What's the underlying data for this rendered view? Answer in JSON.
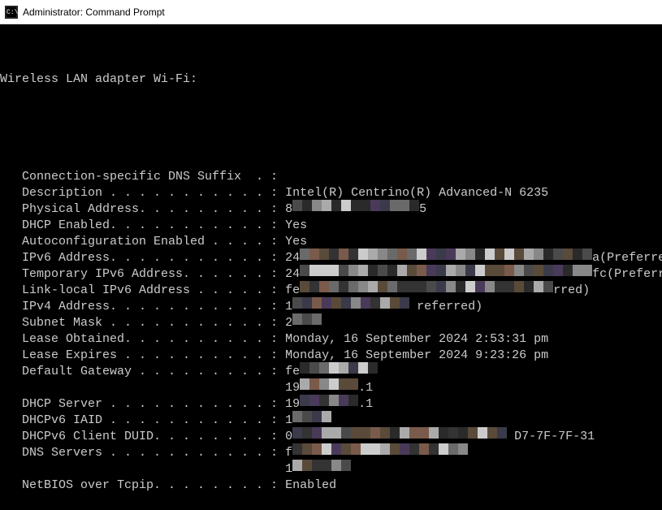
{
  "titlebar": {
    "title": "Administrator: Command Prompt"
  },
  "terminal": {
    "header": "Wireless LAN adapter Wi-Fi:",
    "rows": [
      {
        "label": "   Connection-specific DNS Suffix  . :",
        "value": ""
      },
      {
        "label": "   Description . . . . . . . . . . . : ",
        "value": "Intel(R) Centrino(R) Advanced-N 6235"
      },
      {
        "label": "   Physical Address. . . . . . . . . : ",
        "value_prefix": "8",
        "value_suffix": "5",
        "redacted": true,
        "redact_width": 13
      },
      {
        "label": "   DHCP Enabled. . . . . . . . . . . : ",
        "value": "Yes"
      },
      {
        "label": "   Autoconfiguration Enabled . . . . : ",
        "value": "Yes"
      },
      {
        "label": "   IPv6 Address. . . . . . . . . . . : ",
        "value_prefix": "24",
        "value_suffix": "a(Preferred)",
        "redacted": true,
        "redact_width": 30
      },
      {
        "label": "   Temporary IPv6 Address. . . . . . : ",
        "value_prefix": "24",
        "value_suffix": "fc(Preferred)",
        "redacted": true,
        "redact_width": 30
      },
      {
        "label": "   Link-local IPv6 Address . . . . . : ",
        "value_prefix": "fe",
        "value_suffix": "rred)",
        "redacted": true,
        "redact_width": 26
      },
      {
        "label": "   IPv4 Address. . . . . . . . . . . : ",
        "value_prefix": "1",
        "value_mid": " referred)",
        "redacted": true,
        "redact_width": 12
      },
      {
        "label": "   Subnet Mask . . . . . . . . . . . : ",
        "value_prefix": "2",
        "redacted": true,
        "redact_width": 3
      },
      {
        "label": "   Lease Obtained. . . . . . . . . . : ",
        "value": "Monday, 16 September 2024 2:53:31 pm"
      },
      {
        "label": "   Lease Expires . . . . . . . . . . : ",
        "value": "Monday, 16 September 2024 9:23:26 pm"
      },
      {
        "label": "   Default Gateway . . . . . . . . . : ",
        "value_prefix": "fe",
        "redacted": true,
        "redact_width": 8
      },
      {
        "label": "                                       ",
        "value_prefix": "19",
        "value_suffix": ".1",
        "redacted": true,
        "redact_width": 6
      },
      {
        "label": "   DHCP Server . . . . . . . . . . . : ",
        "value_prefix": "19",
        "value_suffix": ".1",
        "redacted": true,
        "redact_width": 6
      },
      {
        "label": "   DHCPv6 IAID . . . . . . . . . . . : ",
        "value_prefix": "1",
        "redacted": true,
        "redact_width": 4
      },
      {
        "label": "   DHCPv6 Client DUID. . . . . . . . : ",
        "value_prefix": "0",
        "value_suffix": " D7-7F-7F-31",
        "redacted": true,
        "redact_width": 22
      },
      {
        "label": "   DNS Servers . . . . . . . . . . . : ",
        "value_prefix": "f",
        "redacted": true,
        "redact_width": 18
      },
      {
        "label": "                                       ",
        "value_prefix": "1",
        "redacted": true,
        "redact_width": 6
      },
      {
        "label": "   NetBIOS over Tcpip. . . . . . . . : ",
        "value": "Enabled"
      }
    ]
  }
}
